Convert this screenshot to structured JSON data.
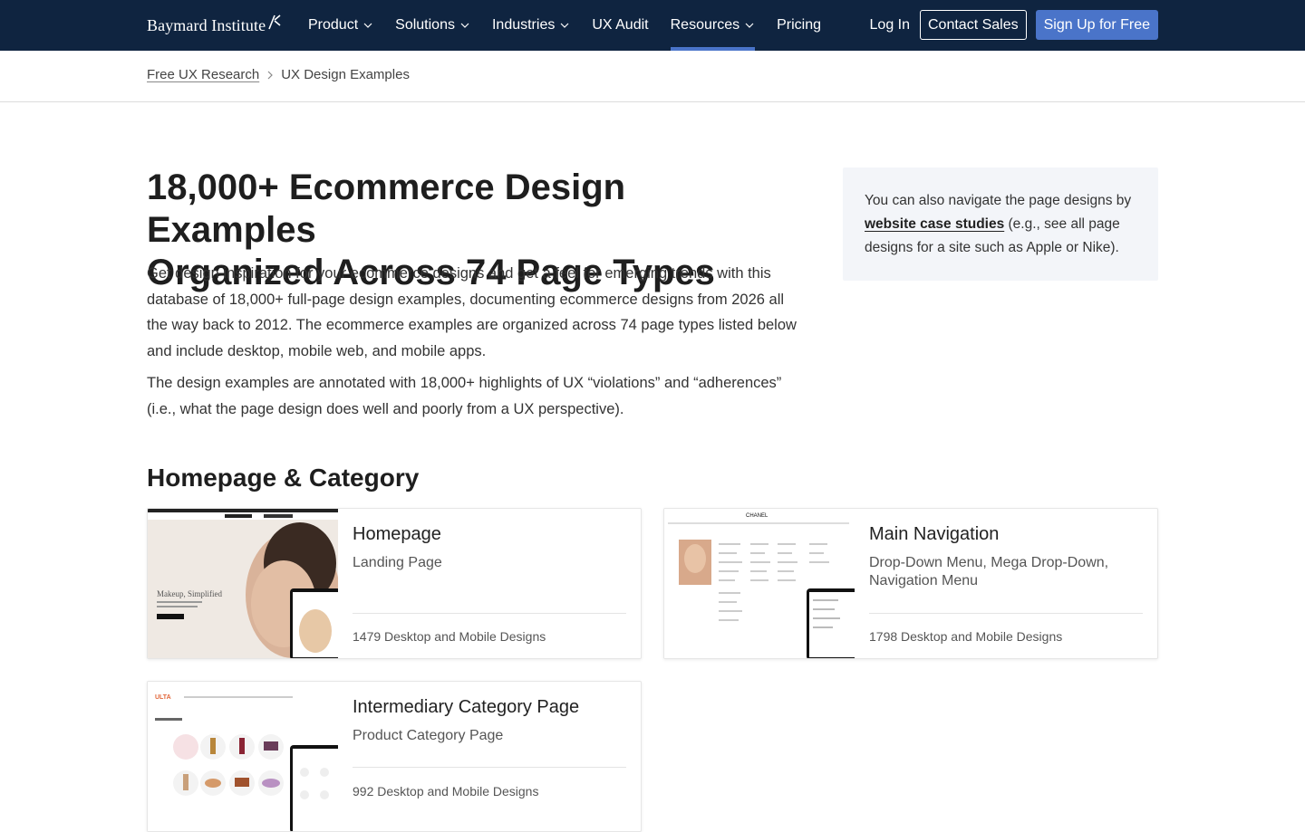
{
  "header": {
    "logo_text": "Baymard Institute",
    "nav": [
      {
        "label": "Product",
        "has_menu": true
      },
      {
        "label": "Solutions",
        "has_menu": true
      },
      {
        "label": "Industries",
        "has_menu": true
      },
      {
        "label": "UX Audit",
        "has_menu": false
      },
      {
        "label": "Resources",
        "has_menu": true,
        "active": true
      },
      {
        "label": "Pricing",
        "has_menu": false
      }
    ],
    "login_label": "Log In",
    "contact_label": "Contact Sales",
    "signup_label": "Sign Up for Free",
    "colors": {
      "nav_bg": "#0f2440",
      "accent": "#4a74c9"
    }
  },
  "breadcrumb": {
    "parent": "Free UX Research",
    "current": "UX Design Examples"
  },
  "hero": {
    "title_line1": "18,000+ Ecommerce Design Examples",
    "title_line2": "Organized Across 74 Page Types",
    "paragraph1": "Get design inspiration for your ecommerce designs and get a feel for emerging trends with this database of 18,000+ full-page design examples, documenting ecommerce designs from 2026 all the way back to 2012. The ecommerce examples are organized across 74 page types listed below and include desktop, mobile web, and mobile apps.",
    "paragraph2": "The design examples are annotated with 18,000+ highlights of UX “violations” and “adherences” (i.e., what the page design does well and poorly from a UX perspective)."
  },
  "side_note": {
    "before": "You can also navigate the page designs by ",
    "link": "website case studies",
    "after": " (e.g., see all page designs for a site such as Apple or Nike)."
  },
  "section": {
    "title": "Homepage & Category"
  },
  "cards": [
    {
      "title": "Homepage",
      "subtitle": "Landing Page",
      "count": "1479 Desktop and Mobile Designs",
      "thumb_text": "Makeup, Simplified"
    },
    {
      "title": "Main Navigation",
      "subtitle": "Drop-Down Menu, Mega Drop-Down, Navigation Menu",
      "count": "1798 Desktop and Mobile Designs",
      "thumb_text": "CHANEL"
    },
    {
      "title": "Intermediary Category Page",
      "subtitle": "Product Category Page",
      "count": "992 Desktop and Mobile Designs",
      "thumb_text": "ULTA"
    }
  ]
}
